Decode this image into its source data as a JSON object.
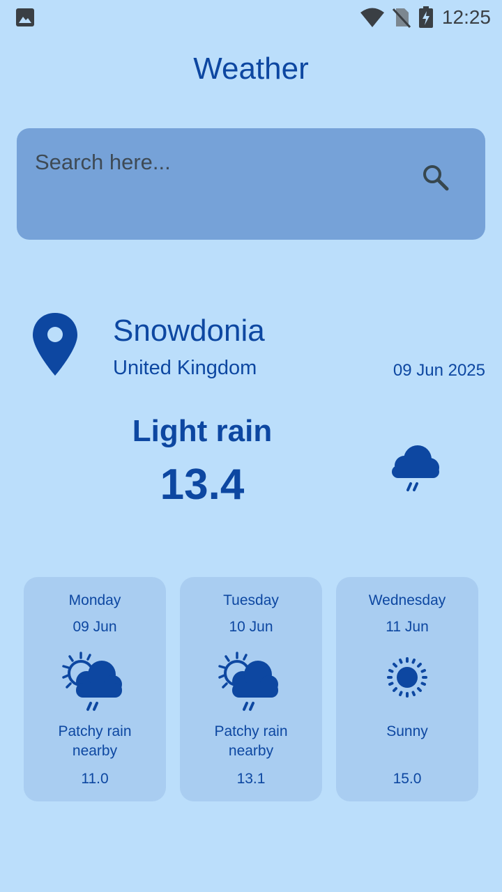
{
  "status_bar": {
    "time": "12:25",
    "icons": [
      "gallery-icon",
      "wifi-icon",
      "no-sim-icon",
      "battery-charging-icon"
    ]
  },
  "app": {
    "title": "Weather"
  },
  "search": {
    "placeholder": "Search here...",
    "value": "",
    "icon": "search-icon"
  },
  "location": {
    "icon": "location-pin-icon",
    "city": "Snowdonia",
    "country": "United Kingdom",
    "date": "09 Jun 2025"
  },
  "current": {
    "condition": "Light rain",
    "temperature": "13.4",
    "icon": "rain-cloud-icon"
  },
  "forecast": [
    {
      "day": "Monday",
      "date": "09 Jun",
      "icon": "sun-cloud-rain-icon",
      "description": "Patchy rain nearby",
      "temperature": "11.0"
    },
    {
      "day": "Tuesday",
      "date": "10 Jun",
      "icon": "sun-cloud-rain-icon",
      "description": "Patchy rain nearby",
      "temperature": "13.1"
    },
    {
      "day": "Wednesday",
      "date": "11 Jun",
      "icon": "sun-icon",
      "description": "Sunny",
      "temperature": "15.0"
    }
  ],
  "colors": {
    "background": "#BBDEFB",
    "primary": "#0D47A1",
    "search_box": "#76A2D8",
    "card": "#A9CDF1"
  }
}
